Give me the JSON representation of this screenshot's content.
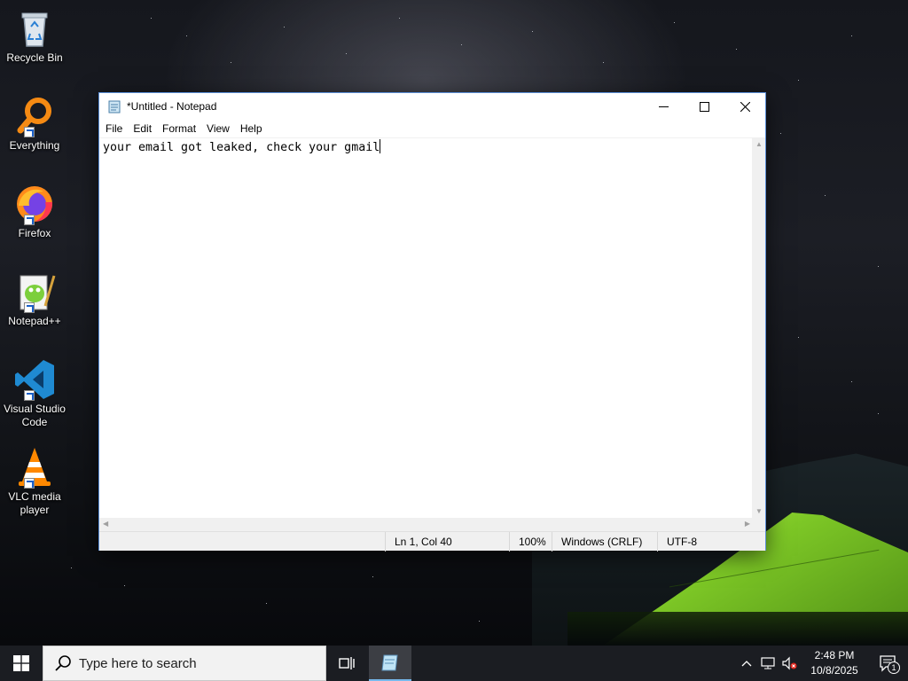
{
  "desktop": {
    "icons": [
      {
        "label": "Recycle Bin",
        "icon": "recycle-bin-icon"
      },
      {
        "label": "Everything",
        "icon": "everything-search-icon"
      },
      {
        "label": "Firefox",
        "icon": "firefox-icon"
      },
      {
        "label": "Notepad++",
        "icon": "notepadpp-icon"
      },
      {
        "label": "Visual Studio Code",
        "icon": "vscode-icon"
      },
      {
        "label": "VLC media player",
        "icon": "vlc-icon"
      }
    ]
  },
  "notepad": {
    "title": "*Untitled - Notepad",
    "menu": [
      "File",
      "Edit",
      "Format",
      "View",
      "Help"
    ],
    "content": "your email got leaked, check your gmail",
    "status": {
      "position": "Ln 1, Col 40",
      "zoom": "100%",
      "line_ending": "Windows (CRLF)",
      "encoding": "UTF-8"
    }
  },
  "taskbar": {
    "search_placeholder": "Type here to search",
    "time": "2:48 PM",
    "date": "10/8/2025",
    "notification_count": "1"
  },
  "colors": {
    "window_border": "#5b8fd8",
    "taskbar_bg": "#1b1d22",
    "active_indicator": "#76b9ed"
  }
}
